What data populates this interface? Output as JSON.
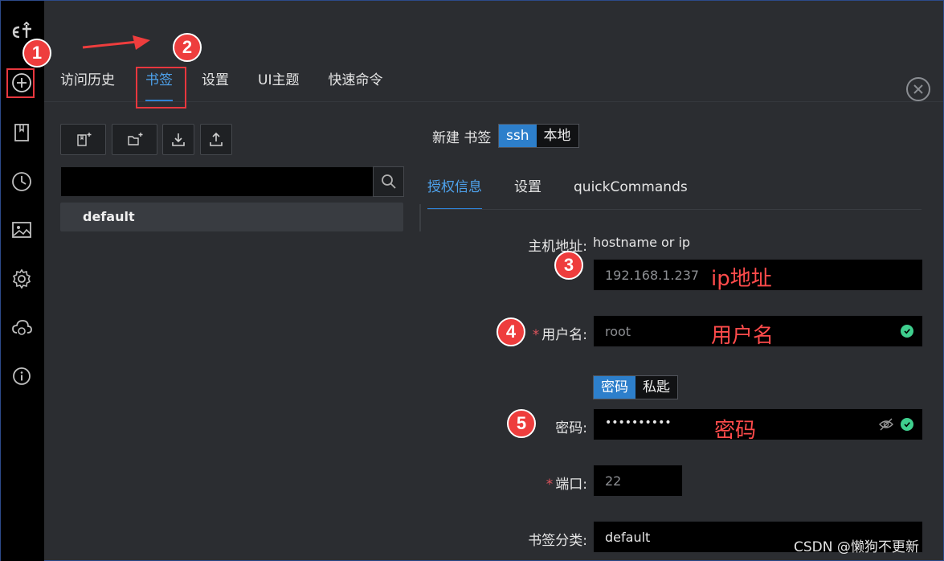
{
  "sidebar": {
    "icons": [
      "logo-icon",
      "add-circle-icon",
      "bookmark-icon",
      "history-icon",
      "image-icon",
      "gear-icon",
      "cloud-sync-icon",
      "info-icon"
    ]
  },
  "top_tabs": [
    {
      "label": "访问历史"
    },
    {
      "label": "书签",
      "active": true
    },
    {
      "label": "设置"
    },
    {
      "label": "UI主题"
    },
    {
      "label": "快速命令"
    }
  ],
  "toolbar": {
    "buttons": [
      "new-bookmark-icon",
      "new-folder-icon",
      "import-icon",
      "export-icon"
    ]
  },
  "tree": {
    "items": [
      {
        "label": "default"
      }
    ]
  },
  "form": {
    "new_label": "新建 书签",
    "type_options": [
      "ssh",
      "本地"
    ],
    "type_selected": "ssh",
    "tabs": [
      {
        "label": "授权信息",
        "active": true
      },
      {
        "label": "设置"
      },
      {
        "label": "quickCommands"
      }
    ],
    "host": {
      "label": "主机地址:",
      "hint": "hostname or ip",
      "value": "192.168.1.237"
    },
    "username": {
      "label": "用户名:",
      "value": "root"
    },
    "auth_options": [
      "密码",
      "私匙"
    ],
    "auth_selected": "密码",
    "password": {
      "label": "密码:",
      "value": "••••••••••"
    },
    "port": {
      "label": "端口:",
      "value": "22"
    },
    "category": {
      "label": "书签分类:",
      "value": "default"
    }
  },
  "annotations": {
    "badges": [
      "1",
      "2",
      "3",
      "4",
      "5"
    ],
    "notes": {
      "ip": "ip地址",
      "user": "用户名",
      "pwd": "密码"
    },
    "color": "#ee3d3d"
  },
  "watermark": "CSDN @懒狗不更新",
  "colors": {
    "accent": "#2d7fcb",
    "background": "#2b2d31",
    "sidebar": "#000000",
    "valid": "#3fcf8e"
  }
}
